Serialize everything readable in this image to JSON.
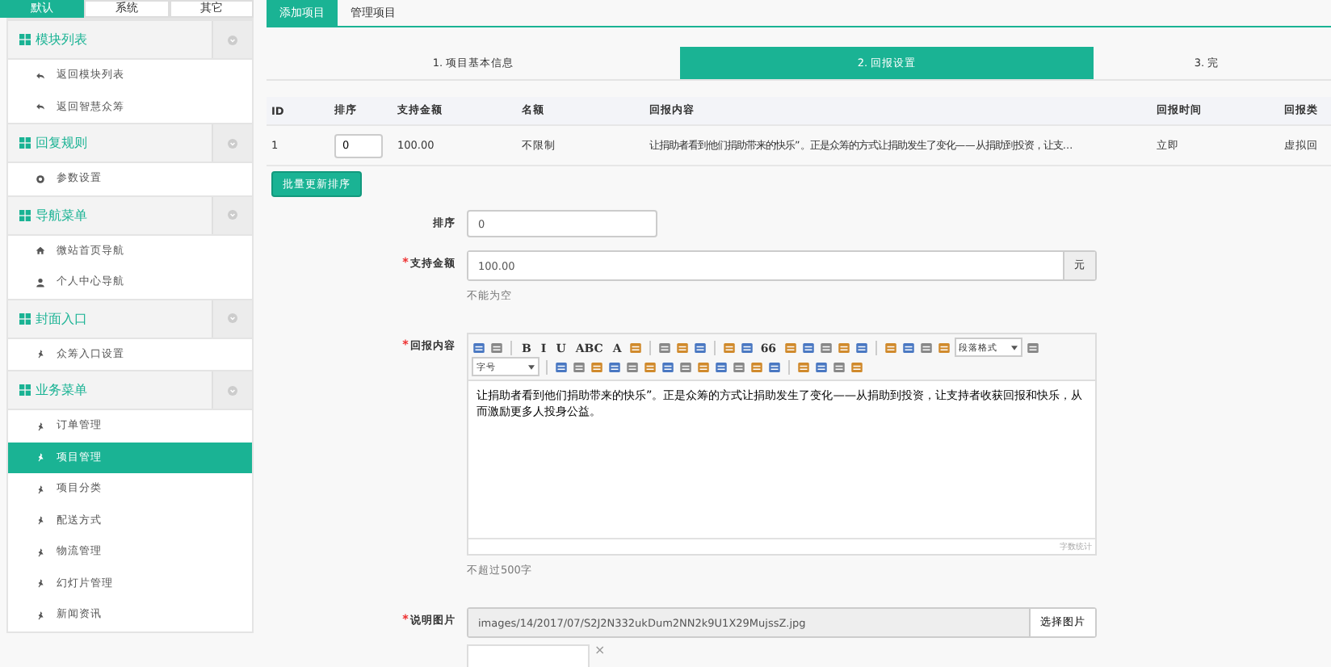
{
  "sidebar": {
    "tabs": [
      {
        "label": "默认",
        "selected": true
      },
      {
        "label": "系统",
        "selected": false
      },
      {
        "label": "其它",
        "selected": false
      }
    ],
    "groups": [
      {
        "title": "模块列表",
        "items": [
          {
            "label": "返回模块列表",
            "kind": "reply",
            "selected": false
          },
          {
            "label": "返回智慧众筹",
            "kind": "reply",
            "selected": false
          }
        ]
      },
      {
        "title": "回复规则",
        "items": [
          {
            "label": "参数设置",
            "kind": "gear",
            "selected": false
          }
        ]
      },
      {
        "title": "导航菜单",
        "items": [
          {
            "label": "微站首页导航",
            "kind": "home",
            "selected": false
          },
          {
            "label": "个人中心导航",
            "kind": "user",
            "selected": false
          }
        ]
      },
      {
        "title": "封面入口",
        "items": [
          {
            "label": "众筹入口设置",
            "kind": "pin",
            "selected": false
          }
        ]
      },
      {
        "title": "业务菜单",
        "items": [
          {
            "label": "订单管理",
            "kind": "pin",
            "selected": false
          },
          {
            "label": "项目管理",
            "kind": "pin",
            "selected": true
          },
          {
            "label": "项目分类",
            "kind": "pin",
            "selected": false
          },
          {
            "label": "配送方式",
            "kind": "pin",
            "selected": false
          },
          {
            "label": "物流管理",
            "kind": "pin",
            "selected": false
          },
          {
            "label": "幻灯片管理",
            "kind": "pin",
            "selected": false
          },
          {
            "label": "新闻资讯",
            "kind": "pin",
            "selected": false
          }
        ]
      }
    ]
  },
  "tabs": [
    {
      "label": "添加项目",
      "selected": true
    },
    {
      "label": "管理项目",
      "selected": false
    }
  ],
  "steps": [
    {
      "label": "1. 项目基本信息",
      "selected": false
    },
    {
      "label": "2. 回报设置",
      "selected": true
    },
    {
      "label": "3. 完",
      "selected": false
    }
  ],
  "table": {
    "columns": [
      "ID",
      "排序",
      "支持金额",
      "名额",
      "回报内容",
      "回报时间",
      "回报类"
    ],
    "rows": [
      {
        "id": "1",
        "sort": "0",
        "amount": "100.00",
        "quota": "不限制",
        "content": "让捐助者看到他们捐助带来的快乐”。正是众筹的方式让捐助发生了变化——从捐助到投资，让支…",
        "time": "立即",
        "type": "虚拟回"
      }
    ]
  },
  "batch_button": "批量更新排序",
  "form": {
    "sort": {
      "label": "排序",
      "value": "0"
    },
    "amount": {
      "label": "支持金额",
      "required": true,
      "value": "100.00",
      "unit": "元",
      "hint": "不能为空"
    },
    "content": {
      "label": "回报内容",
      "required": true,
      "text": "让捐助者看到他们捐助带来的快乐”。正是众筹的方式让捐助发生了变化——从捐助到投资，让支持者收获回报和快乐，从而激励更多人投身公益。",
      "counter": "字数统计",
      "hint": "不超过500字"
    },
    "image": {
      "label": "说明图片",
      "required": true,
      "value": "images/14/2017/07/S2J2N332ukDum2NN2k9U1X29MujssZ.jpg",
      "button": "选择图片",
      "remove": "×"
    }
  },
  "toolbar": [
    {
      "kind": "icon"
    },
    {
      "kind": "icon"
    },
    {
      "kind": "sep"
    },
    {
      "kind": "glyph",
      "label": "B"
    },
    {
      "kind": "glyph",
      "label": "I"
    },
    {
      "kind": "glyph",
      "label": "U"
    },
    {
      "kind": "glyph",
      "label": "ABC"
    },
    {
      "kind": "glyph",
      "label": "A"
    },
    {
      "kind": "icon"
    },
    {
      "kind": "sep"
    },
    {
      "kind": "icon"
    },
    {
      "kind": "icon"
    },
    {
      "kind": "icon"
    },
    {
      "kind": "sep"
    },
    {
      "kind": "icon"
    },
    {
      "kind": "icon"
    },
    {
      "kind": "glyph",
      "label": "66"
    },
    {
      "kind": "icon"
    },
    {
      "kind": "icon"
    },
    {
      "kind": "icon"
    },
    {
      "kind": "icon"
    },
    {
      "kind": "icon"
    },
    {
      "kind": "sep"
    },
    {
      "kind": "icon"
    },
    {
      "kind": "icon"
    },
    {
      "kind": "icon"
    },
    {
      "kind": "icon"
    },
    {
      "kind": "select",
      "label": "段落格式"
    },
    {
      "kind": "icon"
    }
  ],
  "toolbar2": [
    {
      "kind": "select",
      "label": "字号"
    },
    {
      "kind": "sep"
    },
    {
      "kind": "icon"
    },
    {
      "kind": "icon"
    },
    {
      "kind": "icon"
    },
    {
      "kind": "icon"
    },
    {
      "kind": "icon"
    },
    {
      "kind": "icon"
    },
    {
      "kind": "icon"
    },
    {
      "kind": "icon"
    },
    {
      "kind": "icon"
    },
    {
      "kind": "icon"
    },
    {
      "kind": "icon"
    },
    {
      "kind": "icon"
    },
    {
      "kind": "icon"
    },
    {
      "kind": "sep"
    },
    {
      "kind": "icon"
    },
    {
      "kind": "icon"
    },
    {
      "kind": "icon"
    },
    {
      "kind": "icon"
    }
  ]
}
